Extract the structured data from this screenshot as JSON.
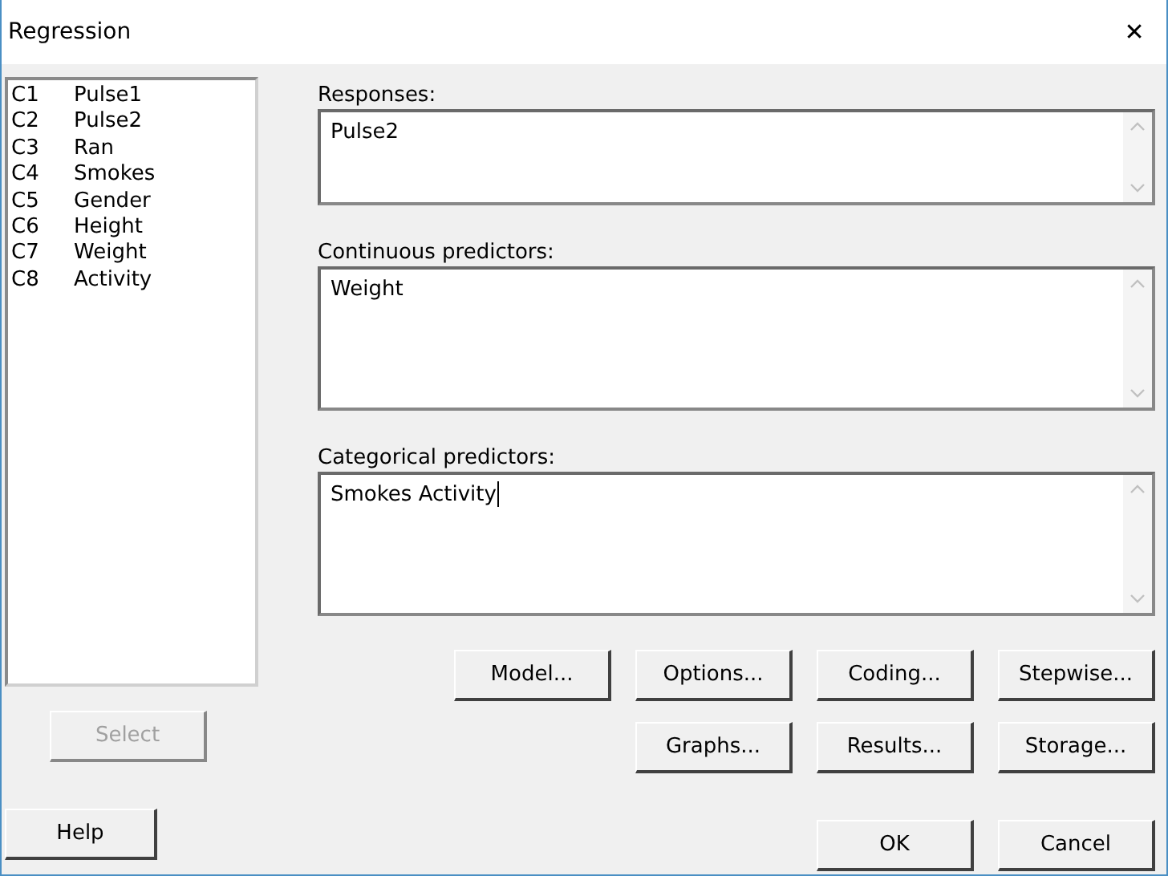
{
  "window": {
    "title": "Regression",
    "close": "✕"
  },
  "columns_list": [
    {
      "id": "C1",
      "name": "Pulse1"
    },
    {
      "id": "C2",
      "name": "Pulse2"
    },
    {
      "id": "C3",
      "name": "Ran"
    },
    {
      "id": "C4",
      "name": "Smokes"
    },
    {
      "id": "C5",
      "name": "Gender"
    },
    {
      "id": "C6",
      "name": "Height"
    },
    {
      "id": "C7",
      "name": "Weight"
    },
    {
      "id": "C8",
      "name": "Activity"
    }
  ],
  "fields": [
    {
      "label": "Responses:",
      "value": "Pulse2",
      "focused": false
    },
    {
      "label": "Continuous predictors:",
      "value": "Weight",
      "focused": false
    },
    {
      "label": "Categorical predictors:",
      "value": "Smokes Activity",
      "focused": true
    }
  ],
  "select_button": {
    "label": "Select",
    "disabled": true
  },
  "option_buttons": [
    [
      "Model...",
      "Options...",
      "Coding...",
      "Stepwise..."
    ],
    [
      "Graphs...",
      "Results...",
      "Storage..."
    ]
  ],
  "help_button": "Help",
  "dialog_buttons": [
    "OK",
    "Cancel"
  ]
}
